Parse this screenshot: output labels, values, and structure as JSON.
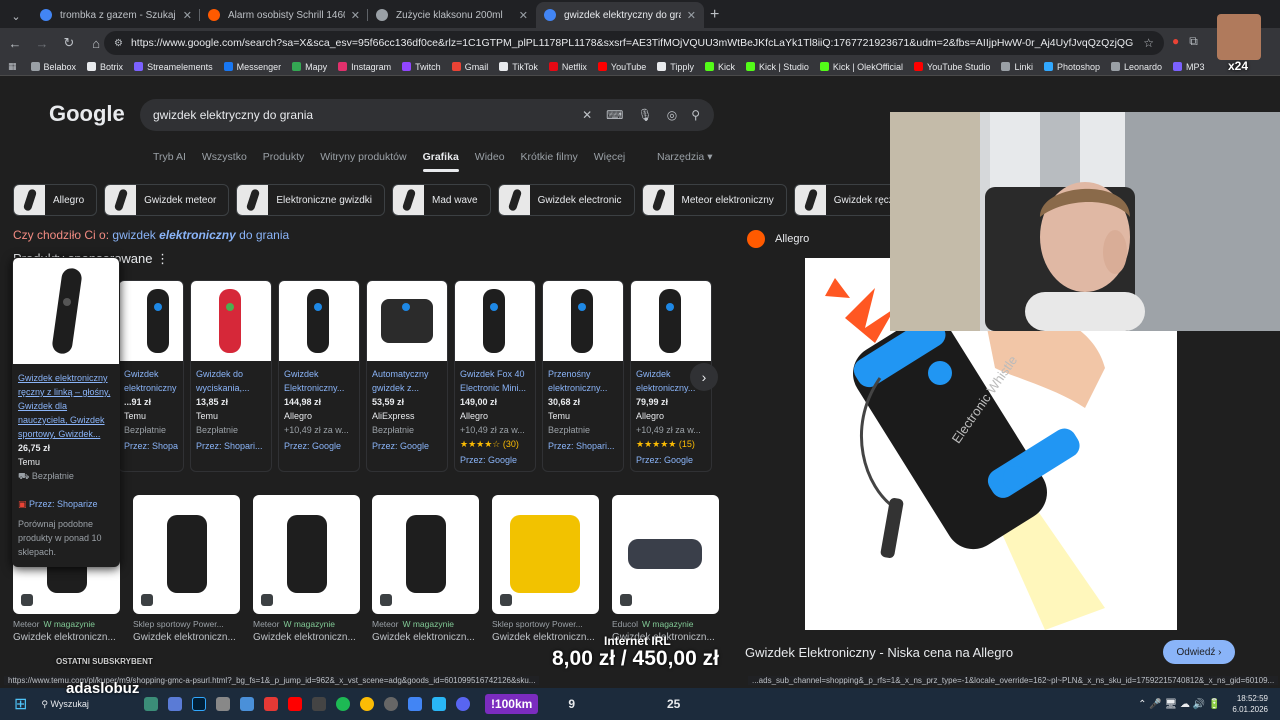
{
  "browser": {
    "tabs": [
      {
        "title": "trombka z gazem - Szukaj w Go",
        "color": "#4285f4",
        "active": false
      },
      {
        "title": "Alarm osobisty Schrill 1460 - 40",
        "color": "#ff5a00",
        "active": false
      },
      {
        "title": "Zużycie klaksonu 200ml",
        "color": "#9aa0a6",
        "active": false
      },
      {
        "title": "gwizdek elektryczny do grania",
        "color": "#4285f4",
        "active": true
      }
    ],
    "url": "https://www.google.com/search?sa=X&sca_esv=95f66cc136df0ce&rlz=1C1GTPM_plPL1178PL1178&sxsrf=AE3TifMOjVQUU3mWtBeJKfcLaYk1Tl8iiQ:1767721923671&udm=2&fbs=AIIjpHwW-0r_Aj4UyfJvqQzQzjQGPkdFwNWJMp7ONeF1JSw4l...",
    "bookmarks": [
      {
        "label": "Belabox",
        "color": "#9aa0a6"
      },
      {
        "label": "Botrix",
        "color": "#e8eaed"
      },
      {
        "label": "Streamelements",
        "color": "#7b61ff"
      },
      {
        "label": "Messenger",
        "color": "#1877f2"
      },
      {
        "label": "Mapy",
        "color": "#34a853"
      },
      {
        "label": "Instagram",
        "color": "#e1306c"
      },
      {
        "label": "Twitch",
        "color": "#9146ff"
      },
      {
        "label": "Gmail",
        "color": "#ea4335"
      },
      {
        "label": "TikTok",
        "color": "#e8eaed"
      },
      {
        "label": "Netflix",
        "color": "#e50914"
      },
      {
        "label": "YouTube",
        "color": "#ff0000"
      },
      {
        "label": "Tipply",
        "color": "#e8eaed"
      },
      {
        "label": "Kick",
        "color": "#53fc18"
      },
      {
        "label": "Kick | Studio",
        "color": "#53fc18"
      },
      {
        "label": "Kick | OlekOfficial",
        "color": "#53fc18"
      },
      {
        "label": "YouTube Studio",
        "color": "#ff0000"
      },
      {
        "label": "Linki",
        "color": "#9aa0a6"
      },
      {
        "label": "Photoshop",
        "color": "#31a8ff"
      },
      {
        "label": "Leonardo",
        "color": "#9aa0a6"
      },
      {
        "label": "MP3",
        "color": "#7b61ff"
      }
    ],
    "extension_badge": "x24"
  },
  "search": {
    "logo": "Google",
    "query": "gwizdek elektryczny do grania",
    "tabs": [
      "Tryb AI",
      "Wszystko",
      "Produkty",
      "Witryny produktów",
      "Grafika",
      "Wideo",
      "Krótkie filmy",
      "Więcej"
    ],
    "active_tab": "Grafika",
    "tools": "Narzędzia",
    "chips": [
      "Allegro",
      "Gwizdek meteor",
      "Elektroniczne gwizdki",
      "Mad wave",
      "Gwizdek electronic",
      "Meteor elektroniczny",
      "Gwizdek ręczny"
    ],
    "did_you_mean_prefix": "Czy chodziło Ci o:",
    "did_you_mean_pre": "gwizdek",
    "did_you_mean_em": "elektroniczny",
    "did_you_mean_post": "do grania",
    "sponsored_heading": "Produkty sponsorowane"
  },
  "popup": {
    "title": "Gwizdek elektroniczny ręczny z linką – głośny, Gwizdek dla nauczyciela, Gwizdek sportowy, Gwizdek...",
    "price": "26,75 zł",
    "store": "Temu",
    "shipping": "Bezpłatnie",
    "by": "Przez: Shoparize",
    "compare": "Porównaj podobne produkty w ponad 10 sklepach."
  },
  "products": [
    {
      "title": "Gwizdek elektroniczny ...",
      "price": "...91 zł",
      "store": "Temu",
      "shipping": "Bezpłatnie",
      "by": "Przez: Shopari..."
    },
    {
      "title": "Gwizdek do wyciskania,...",
      "price": "13,85 zł",
      "store": "Temu",
      "shipping": "Bezpłatnie",
      "by": "Przez: Shopari..."
    },
    {
      "title": "Gwizdek Elektroniczny...",
      "price": "144,98 zł",
      "store": "Allegro",
      "shipping": "+10,49 zł za w...",
      "by": "Przez: Google"
    },
    {
      "title": "Automatyczny gwizdek z...",
      "price": "53,59 zł",
      "store": "AliExpress",
      "shipping": "Bezpłatnie",
      "by": "Przez: Google"
    },
    {
      "title": "Gwizdek Fox 40 Electronic Mini...",
      "price": "149,00 zł",
      "store": "Allegro",
      "shipping": "+10,49 zł za w...",
      "rating": "★★★★☆ (30)",
      "by": "Przez: Google"
    },
    {
      "title": "Przenośny elektroniczny...",
      "price": "30,68 zł",
      "store": "Temu",
      "shipping": "Bezpłatnie",
      "by": "Przez: Shopari..."
    },
    {
      "title": "Gwizdek elektroniczny...",
      "price": "79,99 zł",
      "store": "Allegro",
      "shipping": "+10,49 zł za w...",
      "rating": "★★★★★ (15)",
      "by": "Przez: Google"
    }
  ],
  "grid": [
    {
      "source": "Meteor",
      "badge": "W magazynie",
      "title": "Gwizdek elektroniczn..."
    },
    {
      "source": "Sklep sportowy Power...",
      "badge": "",
      "title": "Gwizdek elektroniczn..."
    },
    {
      "source": "Meteor",
      "badge": "W magazynie",
      "title": "Gwizdek elektroniczn..."
    },
    {
      "source": "Meteor",
      "badge": "W magazynie",
      "title": "Gwizdek elektroniczn..."
    },
    {
      "source": "Sklep sportowy Power...",
      "badge": "",
      "title": "Gwizdek elektroniczn..."
    },
    {
      "source": "Educol",
      "badge": "W magazynie",
      "title": "Gwizdek elektroniczn..."
    }
  ],
  "right_panel": {
    "source": "Allegro",
    "title": "Gwizdek Elektroniczny - Niska cena na Allegro",
    "visit": "Odwiedź",
    "product_text": "Electronic Whistle"
  },
  "statusbar": {
    "left": "https://www.temu.com/pl/kuper/m9/shopping-gmc-a-psurl.html?_bg_fs=1&_p_jump_id=962&_x_vst_scene=adg&goods_id=601099516742126&sku...",
    "right": "...ads_sub_channel=shopping&_p_rfs=1&_x_ns_prz_type=-1&locale_override=162~pl~PLN&_x_ns_sku_id=17592215740812&_x_ns_gid=60109..."
  },
  "overlay": {
    "username": "adaslobuz",
    "irl_label": "Internet IRL",
    "irl_amount": "8,00 zł / 450,00 zł",
    "distance": "!100km",
    "count_a": "9",
    "count_b": "25",
    "subs_label": "OSTATNI SUBSKRYBENT"
  },
  "taskbar": {
    "search_label": "Wyszukaj",
    "time": "18:52:59",
    "date": "6.01.2026"
  }
}
